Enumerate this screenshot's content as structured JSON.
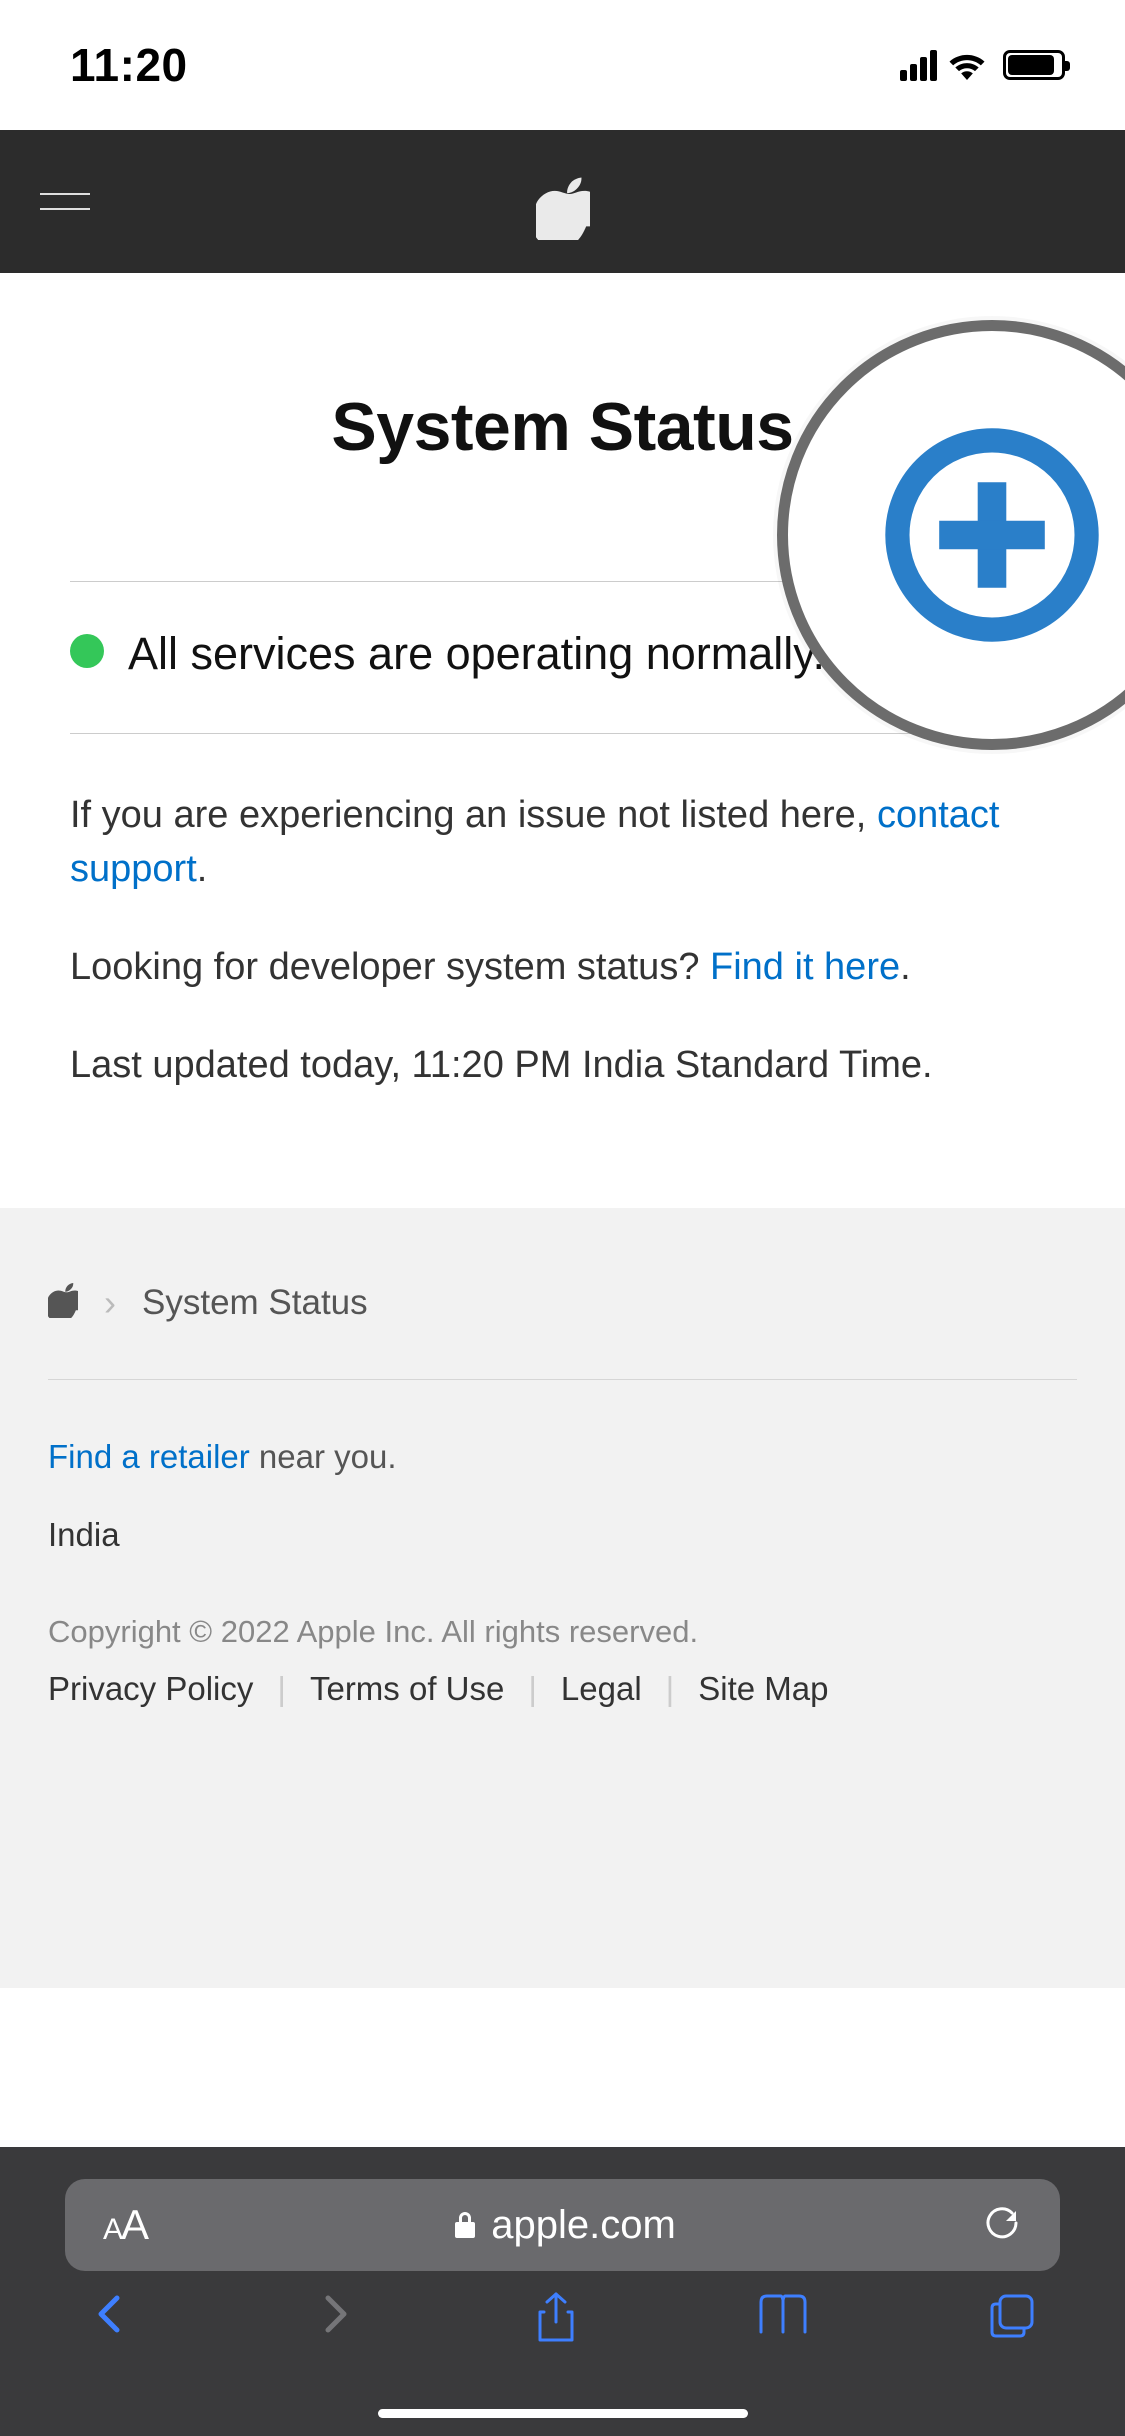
{
  "statusbar": {
    "time": "11:20"
  },
  "nav": {
    "logo": "apple-logo"
  },
  "page": {
    "title": "System Status",
    "status_message": "All services are operating normally.",
    "issue_text_prefix": "If you are experiencing an issue not listed here, ",
    "contact_support_link": "contact support",
    "period": ".",
    "dev_text_prefix": "Looking for developer system status? ",
    "dev_link": "Find it here",
    "last_updated": "Last updated today, 11:20 PM India Standard Time."
  },
  "footer": {
    "breadcrumb": "System Status",
    "retailer_link": "Find a retailer",
    "retailer_suffix": " near you.",
    "country": "India",
    "copyright": "Copyright © 2022 Apple Inc. All rights reserved.",
    "links": {
      "privacy": "Privacy Policy",
      "terms": "Terms of Use",
      "legal": "Legal",
      "sitemap": "Site Map"
    }
  },
  "safari": {
    "aa": "AA",
    "domain": "apple.com"
  }
}
